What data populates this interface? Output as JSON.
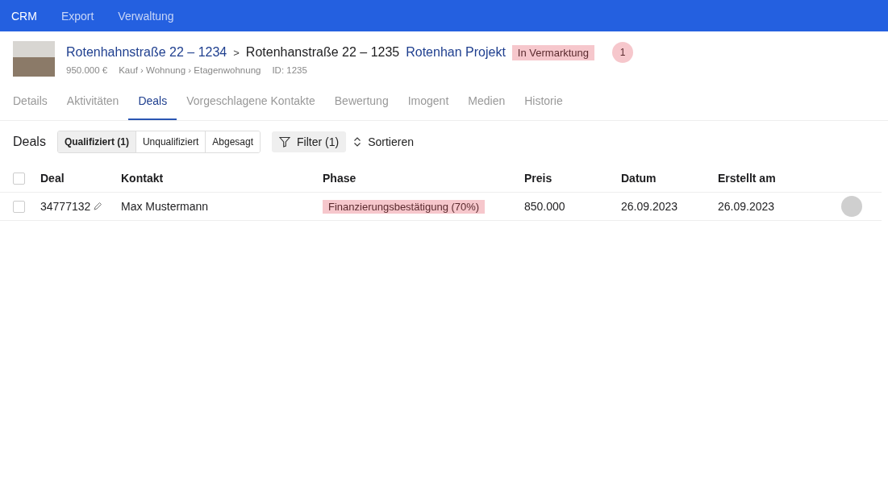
{
  "nav": [
    {
      "label": "CRM",
      "selected": true
    },
    {
      "label": "Export",
      "selected": false
    },
    {
      "label": "Verwaltung",
      "selected": false
    }
  ],
  "header": {
    "breadcrumb": [
      {
        "label": "Rotenhahnstraße 22 – 1234",
        "kind": "link"
      },
      {
        "label": ">",
        "kind": "separator"
      },
      {
        "label": "Rotenhanstraße 22 – 1235",
        "kind": "current"
      },
      {
        "label": "Rotenhan Projekt",
        "kind": "link"
      }
    ],
    "status": "In Vermarktung",
    "count": "1",
    "meta": [
      "950.000 €",
      "Kauf › Wohnung › Etagenwohnung",
      "ID: 1235"
    ]
  },
  "tabs": [
    {
      "label": "Details",
      "selected": false
    },
    {
      "label": "Aktivitäten",
      "selected": false
    },
    {
      "label": "Deals",
      "selected": true
    },
    {
      "label": "Vorgeschlagene Kontakte",
      "selected": false
    },
    {
      "label": "Bewertung",
      "selected": false
    },
    {
      "label": "Imogent",
      "selected": false
    },
    {
      "label": "Medien",
      "selected": false
    },
    {
      "label": "Historie",
      "selected": false
    }
  ],
  "toolbar": {
    "title": "Deals",
    "segments": [
      {
        "label": "Qualifiziert (1)",
        "selected": true
      },
      {
        "label": "Unqualifiziert",
        "selected": false
      },
      {
        "label": "Abgesagt",
        "selected": false
      }
    ],
    "filter": "Filter (1)",
    "sort": "Sortieren"
  },
  "table": {
    "columns": [
      "Deal",
      "Kontakt",
      "Phase",
      "Preis",
      "Datum",
      "Erstellt am"
    ],
    "header_checked": false,
    "rows": [
      {
        "checked": false,
        "deal": "34777132",
        "contact": "Max Mustermann",
        "phase": "Finanzierungsbestätigung (70%)",
        "price": "850.000",
        "date": "26.09.2023",
        "created": "26.09.2023"
      }
    ]
  }
}
